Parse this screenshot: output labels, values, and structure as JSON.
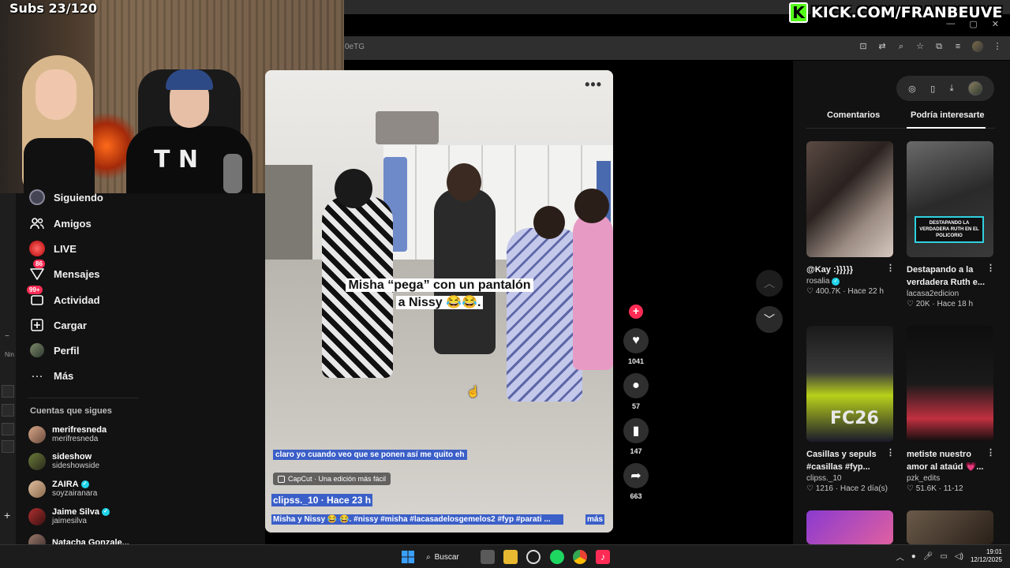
{
  "overlay": {
    "subs": "Subs 23/120",
    "kick_logo": "K",
    "kick_text": "KICK.COM/FRANBEUVE"
  },
  "browser": {
    "address_fragment": "0eTG"
  },
  "left_strip": {
    "truncated_text": "Nin",
    "minus": "−",
    "plus": "+"
  },
  "sidebar": {
    "nav": [
      {
        "label": "Siguiendo",
        "icon": "following-icon"
      },
      {
        "label": "Amigos",
        "icon": "friends-icon"
      },
      {
        "label": "LIVE",
        "icon": "live-icon"
      },
      {
        "label": "Mensajes",
        "icon": "messages-icon",
        "badge": "86"
      },
      {
        "label": "Actividad",
        "icon": "activity-icon",
        "badge": "99+"
      },
      {
        "label": "Cargar",
        "icon": "upload-icon"
      },
      {
        "label": "Perfil",
        "icon": "profile-icon"
      },
      {
        "label": "Más",
        "icon": "more-icon"
      }
    ],
    "following_title": "Cuentas que sigues",
    "following": [
      {
        "name": "merifresneda",
        "handle": "merifresneda",
        "verified": false
      },
      {
        "name": "sideshow",
        "handle": "sideshowside",
        "verified": false
      },
      {
        "name": "ZAIRA",
        "handle": "soyzairanara",
        "verified": true
      },
      {
        "name": "Jaime Silva",
        "handle": "jaimesilva",
        "verified": true
      },
      {
        "name": "Natacha Gonzale...",
        "handle": "",
        "verified": false
      }
    ]
  },
  "video": {
    "more": "•••",
    "caption": "Misha “pega” con un pantalón a Nissy 😂😂.",
    "overlay_text": "claro yo cuando veo que se ponen así me quito eh",
    "capcut": "CapCut · Una edición más fácil",
    "author_line": "clipss._10 · Hace 23 h",
    "description": "Misha y Nissy 😂 😂. #nissy #misha #lacasadelosgemelos2 #fyp #parati ...",
    "more_label": "más"
  },
  "actions": {
    "follow_plus": "+",
    "likes": "1041",
    "comments": "57",
    "saves": "147",
    "shares": "663"
  },
  "right_panel": {
    "tabs": [
      "Comentarios",
      "Podría interesarte"
    ],
    "active_tab": 1,
    "cards": [
      {
        "title": "@Kay :}}}}}",
        "author": "rosalia",
        "verified": true,
        "likes": "400.7K",
        "time": "Hace 22 h"
      },
      {
        "title": "Destapando a la verdadera Ruth e...",
        "author": "lacasa2edicion",
        "verified": false,
        "likes": "20K",
        "time": "Hace 18 h",
        "thumb_text": "DESTAPANDO LA VERDADERA RUTH EN EL POLICORIO"
      },
      {
        "title": "Casillas y sepuls #casillas #fyp...",
        "author": "clipss._10",
        "verified": false,
        "likes": "1216",
        "time": "Hace 2 día(s)",
        "thumb_text": "FC26"
      },
      {
        "title": "metiste nuestro amor al ataúd 💗...",
        "author": "pzk_edits",
        "verified": false,
        "likes": "51.6K",
        "time": "11-12"
      }
    ]
  },
  "taskbar": {
    "search_label": "Buscar",
    "time": "19:01",
    "date": "12/12/2025"
  },
  "colors": {
    "accent": "#fe2c55",
    "kick_green": "#53fc18",
    "verified": "#20d5ec",
    "selection": "#3b5fc8"
  }
}
